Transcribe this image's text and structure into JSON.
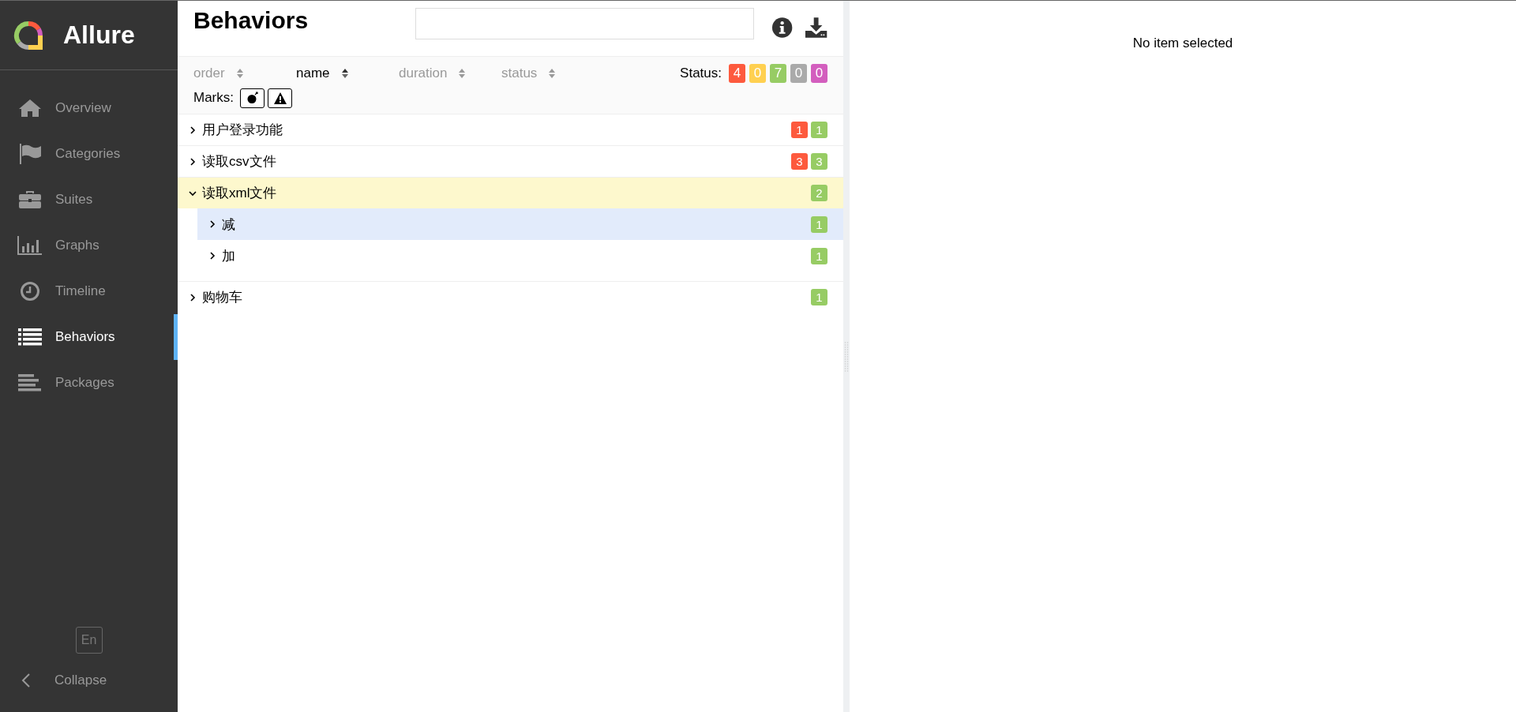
{
  "brand": {
    "title": "Allure"
  },
  "sidebar": {
    "items": [
      {
        "label": "Overview",
        "selected": false
      },
      {
        "label": "Categories",
        "selected": false
      },
      {
        "label": "Suites",
        "selected": false
      },
      {
        "label": "Graphs",
        "selected": false
      },
      {
        "label": "Timeline",
        "selected": false
      },
      {
        "label": "Behaviors",
        "selected": true
      },
      {
        "label": "Packages",
        "selected": false
      }
    ],
    "language": "En",
    "collapse": "Collapse"
  },
  "pane": {
    "title": "Behaviors",
    "sorters": [
      {
        "label": "order",
        "selected": false
      },
      {
        "label": "name",
        "selected": true
      },
      {
        "label": "duration",
        "selected": false
      },
      {
        "label": "status",
        "selected": false
      }
    ],
    "status_label": "Status:",
    "status_filters": [
      {
        "count": "4",
        "color": "#fd5a3e"
      },
      {
        "count": "0",
        "color": "#ffd050"
      },
      {
        "count": "7",
        "color": "#97cc64"
      },
      {
        "count": "0",
        "color": "#aaaaaa"
      },
      {
        "count": "0",
        "color": "#d35ebe"
      }
    ],
    "marks_label": "Marks:"
  },
  "tree": [
    {
      "name": "用户登录功能",
      "expanded": false,
      "selected": false,
      "counts": [
        {
          "count": "1",
          "color": "#fd5a3e"
        },
        {
          "count": "1",
          "color": "#97cc64"
        }
      ]
    },
    {
      "name": "读取csv文件",
      "expanded": false,
      "selected": false,
      "counts": [
        {
          "count": "3",
          "color": "#fd5a3e"
        },
        {
          "count": "3",
          "color": "#97cc64"
        }
      ]
    },
    {
      "name": "读取xml文件",
      "expanded": true,
      "selected": false,
      "counts": [
        {
          "count": "2",
          "color": "#97cc64"
        }
      ],
      "children": [
        {
          "name": "减",
          "expanded": false,
          "selected": true,
          "counts": [
            {
              "count": "1",
              "color": "#97cc64"
            }
          ]
        },
        {
          "name": "加",
          "expanded": false,
          "selected": false,
          "counts": [
            {
              "count": "1",
              "color": "#97cc64"
            }
          ]
        }
      ]
    },
    {
      "name": "购物车",
      "expanded": false,
      "selected": false,
      "counts": [
        {
          "count": "1",
          "color": "#97cc64"
        }
      ]
    }
  ],
  "detail": {
    "empty_text": "No item selected"
  }
}
